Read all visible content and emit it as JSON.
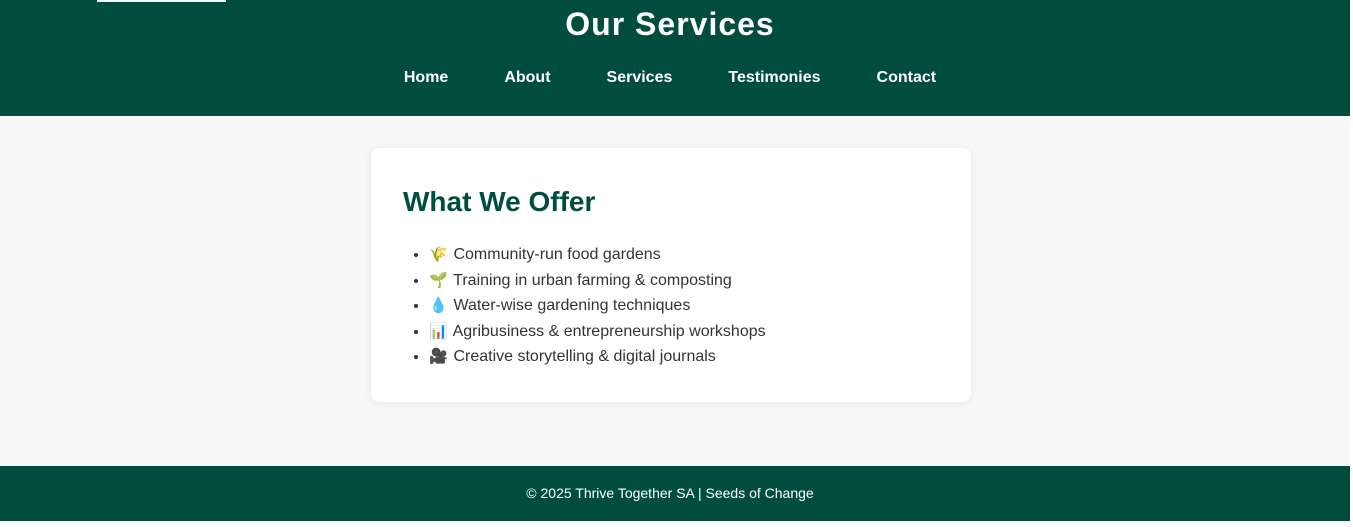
{
  "header": {
    "title": "Our Services",
    "background_color": "#004d40",
    "nav": [
      {
        "label": "Home"
      },
      {
        "label": "About"
      },
      {
        "label": "Services"
      },
      {
        "label": "Testimonies"
      },
      {
        "label": "Contact"
      }
    ]
  },
  "main": {
    "card": {
      "title": "What We Offer",
      "title_color": "#004d40",
      "items": [
        {
          "icon": "🌾",
          "text": "Community-run food gardens"
        },
        {
          "icon": "🌱",
          "text": "Training in urban farming & composting"
        },
        {
          "icon": "💧",
          "text": "Water-wise gardening techniques"
        },
        {
          "icon": "📊",
          "text": "Agribusiness & entrepreneurship workshops"
        },
        {
          "icon": "🎥",
          "text": "Creative storytelling & digital journals"
        }
      ]
    }
  },
  "footer": {
    "text": "© 2025 Thrive Together SA | Seeds of Change"
  }
}
